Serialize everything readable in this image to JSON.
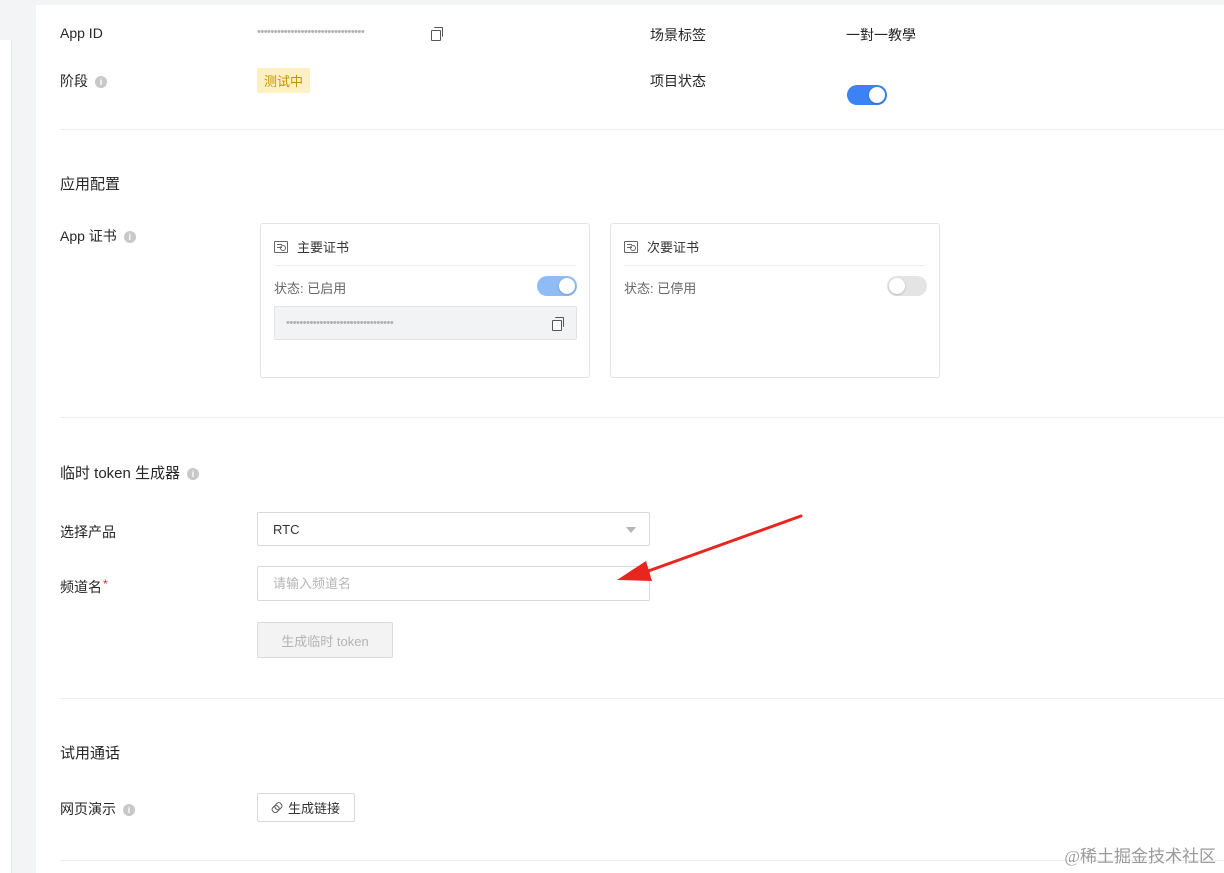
{
  "project_info": {
    "app_id_label": "App ID",
    "app_id_value": "••••••••••••••••••••••••••••••••",
    "stage_label": "阶段",
    "stage_value": "测试中",
    "scene_tag_label": "场景标签",
    "scene_tag_value": "一對一教學",
    "project_status_label": "项目状态",
    "project_status_on": true
  },
  "app_config": {
    "title": "应用配置",
    "cert_label": "App 证书",
    "primary": {
      "title": "主要证书",
      "status": "状态: 已启用",
      "enabled": true,
      "secret_masked": "••••••••••••••••••••••••••••••••"
    },
    "secondary": {
      "title": "次要证书",
      "status": "状态: 已停用",
      "enabled": false
    }
  },
  "token_generator": {
    "title": "临时 token 生成器",
    "product_label": "选择产品",
    "product_value": "RTC",
    "channel_label": "频道名",
    "required_mark": "*",
    "channel_placeholder": "请输入频道名",
    "generate_button": "生成临时 token"
  },
  "trial_call": {
    "title": "试用通话",
    "web_demo_label": "网页演示",
    "generate_link_button": "生成链接"
  },
  "watermark": "@稀土掘金技术社区",
  "colors": {
    "accent": "#3b82f6",
    "badge_bg": "#fdf0c2",
    "badge_text": "#c69100",
    "annotation_arrow": "#e8251f"
  }
}
